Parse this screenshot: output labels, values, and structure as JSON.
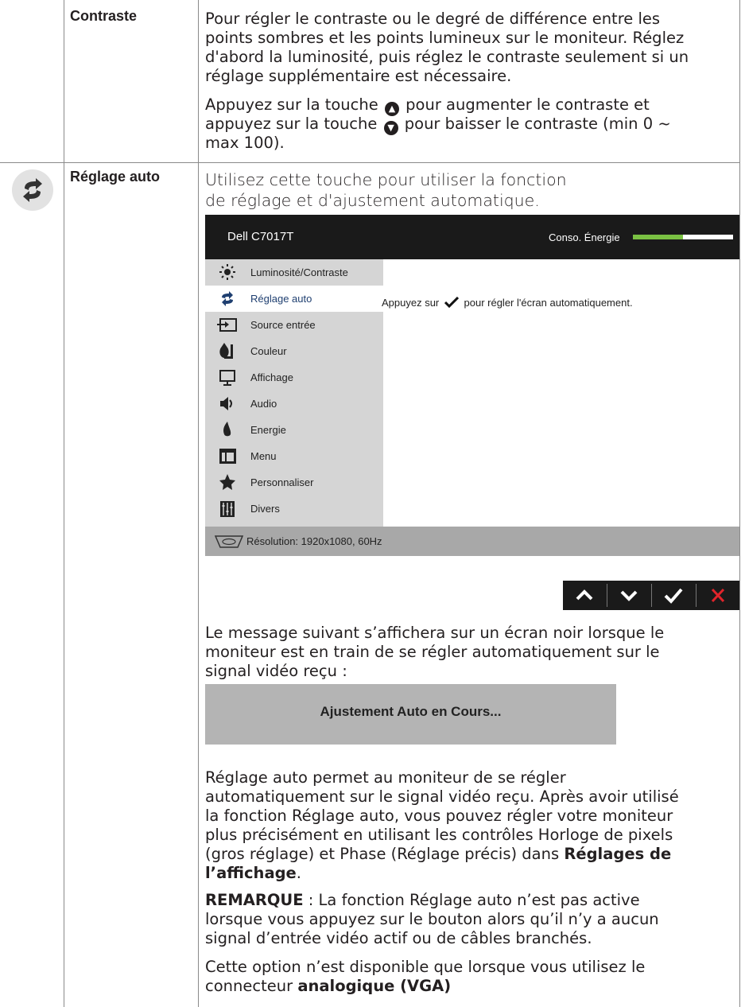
{
  "contrast": {
    "label": "Contraste",
    "p1": [
      "Pour régler le contraste ou le degré de différence entre les",
      "points sombres et les points lumineux sur le moniteur. Réglez",
      "d'abord la luminosité, puis réglez le contraste seulement si un",
      "réglage supplémentaire est nécessaire."
    ],
    "p2_l1_a": "Appuyez sur la touche",
    "p2_l1_b": "pour augmenter le contraste et",
    "p2_l2_a": "appuyez sur la touche",
    "p2_l2_b": "pour baisser le contraste (min 0 ~",
    "p2_l3": "max 100)."
  },
  "auto": {
    "label": "Réglage auto",
    "intro": [
      "Utilisez cette touche pour utiliser la fonction",
      "de réglage et d'ajustement automatique."
    ],
    "osd": {
      "model": "Dell C7017T",
      "energy_label": "Conso. Énergie",
      "energy_level": 0.5,
      "menu": [
        "Luminosité/Contraste",
        "Réglage auto",
        "Source entrée",
        "Couleur",
        "Affichage",
        "Audio",
        "Energie",
        "Menu",
        "Personnaliser",
        "Divers"
      ],
      "selected_index": 1,
      "message_a": "Appuyez sur",
      "message_b": "pour régler l'écran automatiquement.",
      "resolution": "Résolution: 1920x1080, 60Hz"
    },
    "msg": [
      "Le message suivant s’affichera sur un écran noir lorsque le",
      "moniteur est en train de se régler automatiquement sur le",
      "signal vidéo reçu :"
    ],
    "adjust_box": "Ajustement Auto en Cours...",
    "para": [
      "Réglage auto permet au moniteur de se régler",
      "automatiquement sur le signal vidéo reçu. Après avoir utilisé",
      "la fonction Réglage auto, vous pouvez régler votre moniteur",
      "plus précisément en utilisant les contrôles Horloge de pixels",
      "(gros réglage) et Phase (Réglage précis) dans"
    ],
    "para_bold": "Réglages de",
    "para_bold2": "l’affichage",
    "para_end": ".",
    "note_label": "REMARQUE",
    "note": [
      " : La fonction Réglage auto n’est pas active",
      "lorsque vous appuyez sur le bouton alors qu’il n’y a aucun",
      "signal d’entrée vidéo actif ou de câbles branchés."
    ],
    "option": [
      "Cette option n’est disponible que lorsque vous utilisez le",
      "connecteur "
    ],
    "option_bold": "analogique (VGA)"
  },
  "colors": {
    "accent": "#1f3f70",
    "energy": "#7ac143",
    "close": "#e0242b"
  }
}
